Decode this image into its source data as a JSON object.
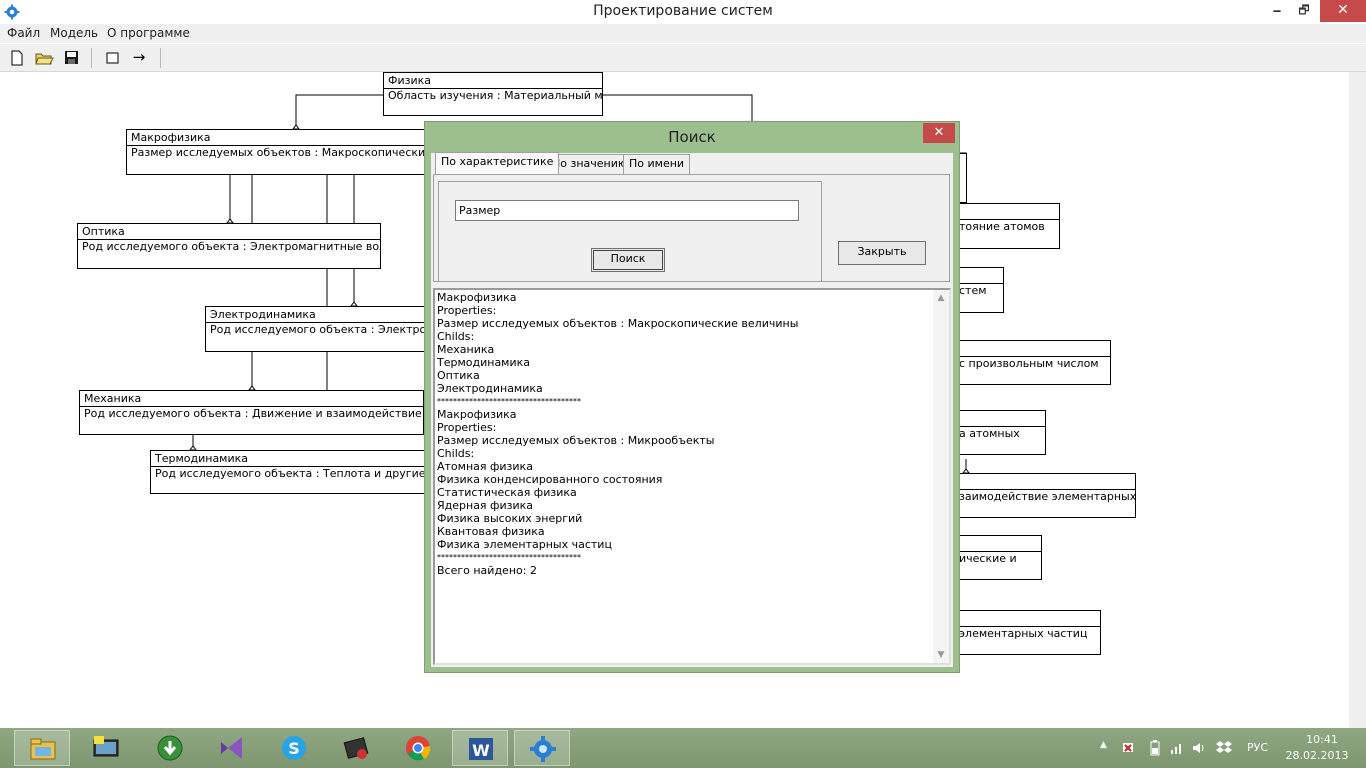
{
  "window": {
    "title": "Проектирование систем",
    "minimize": "🗕",
    "maximize": "🗗",
    "close": "✕"
  },
  "menu": [
    "Файл",
    "Модель",
    "О программе"
  ],
  "toolbar": {
    "icons": [
      "new-file-icon",
      "open-folder-icon",
      "save-icon",
      "rectangle-icon",
      "arrow-right-icon"
    ],
    "arrow": "→"
  },
  "diagram": {
    "physics": {
      "name": "Физика",
      "prop": "Область изучения : Материальный мир"
    },
    "macro": {
      "name": "Макрофизика",
      "prop": "Размер исследуемых объектов : Макроскопические величины"
    },
    "optics": {
      "name": "Оптика",
      "prop": "Род исследуемого объекта : Электромагнитные волны"
    },
    "electro": {
      "name": "Электродинамика",
      "prop": "Род исследуемого объекта : Электромагнитные явления"
    },
    "mechanics": {
      "name": "Механика",
      "prop": "Род исследуемого объекта :  Движение и взаимодействие тел"
    },
    "thermo": {
      "name": "Термодинамика",
      "prop": "Род исследуемого объекта : Теплота и другие формы энергии"
    },
    "right_fragments": [
      "тояние атомов",
      "стем",
      "с произвольным числом",
      "а атомных",
      "заимодействие элементарных",
      "ические и",
      "элементарных частиц"
    ]
  },
  "dialog": {
    "title": "Поиск",
    "close": "✕",
    "tabs": [
      "По характеристике",
      "По значению",
      "По имени"
    ],
    "search_value": "Размер",
    "search_button": "Поиск",
    "close_button": "Закрыть",
    "results": [
      "Макрофизика",
      "Properties:",
      "Размер исследуемых объектов : Макроскопические величины",
      "Childs:",
      "Механика",
      "Термодинамика",
      "Оптика",
      "Электродинамика",
      "************************************",
      "Макрофизика",
      "Properties:",
      "Размер исследуемых объектов : Микрообъекты",
      "Childs:",
      "Атомная физика",
      "Физика конденсированного состояния",
      "Статистическая физика",
      "Ядерная физика",
      "Физика высоких энергий",
      "Квантовая физика",
      "Физика элементарных частиц",
      "************************************",
      "Всего найдено: 2"
    ]
  },
  "taskbar": {
    "apps": [
      "file-explorer-icon",
      "qip-messenger-icon",
      "download-manager-icon",
      "visual-studio-icon",
      "skype-icon",
      "terminal-app-icon",
      "chrome-icon",
      "word-icon",
      "system-design-app-icon"
    ],
    "word_letter": "W",
    "lang": "РУС",
    "time": "10:41",
    "date": "28.02.2013"
  }
}
